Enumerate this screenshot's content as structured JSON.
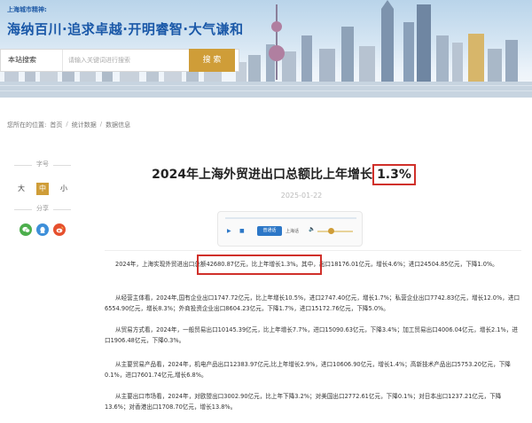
{
  "header": {
    "spirit_label": "上海城市精神:",
    "slogan": "海纳百川·追求卓越·开明睿智·大气谦和",
    "search": {
      "scope": "本站搜索",
      "placeholder": "请输入关键词进行搜索",
      "button": "搜 索"
    }
  },
  "breadcrumb": {
    "prefix": "您所在的位置:",
    "items": [
      "首页",
      "统计数据",
      "数据信息"
    ]
  },
  "tools": {
    "font_title": "字号",
    "font_sizes": [
      "大",
      "中",
      "小"
    ],
    "active_font": "中",
    "share_title": "分享"
  },
  "article": {
    "title_main": "2024年上海外贸进出口总额比上年增长",
    "title_highlight": "1.3%",
    "date": "2025-01-22",
    "player": {
      "voice_button": "普通话",
      "voice_name": "上海话"
    },
    "paragraphs": [
      "2024年，上海实现外贸进出口总额42680.87亿元，比上年增长1.3%。其中，出口18176.01亿元，增长4.6%；进口24504.85亿元，下降1.0%。",
      "从经营主体看，2024年,国有企业出口1747.72亿元，比上年增长10.5%，进口2747.40亿元，增长1.7%；私营企业出口7742.83亿元，增长12.0%，进口6554.90亿元，增长8.3%；外商投资企业出口8604.23亿元，下降1.7%，进口15172.76亿元，下降5.0%。",
      "从贸易方式看，2024年，一般贸易出口10145.39亿元，比上年增长7.7%，进口15090.63亿元，下降3.4%；加工贸易出口4006.04亿元，增长2.1%，进口1906.48亿元，下降0.3%。",
      "从主要贸易产品看，2024年，机电产品出口12383.97亿元,比上年增长2.9%，进口10606.90亿元，增长1.4%；高新技术产品出口5753.20亿元，下降0.1%，进口7601.74亿元,增长6.8%。",
      "从主要出口市场看，2024年，对欧盟出口3002.90亿元，比上年下降3.2%；对美国出口2772.61亿元，下降0.1%；对日本出口1237.21亿元，下降13.6%；对香港出口1708.70亿元，增长13.8%。"
    ]
  },
  "colors": {
    "accent_gold": "#cf9d38",
    "brand_blue": "#1a58a8",
    "highlight_red": "#d0302a"
  }
}
